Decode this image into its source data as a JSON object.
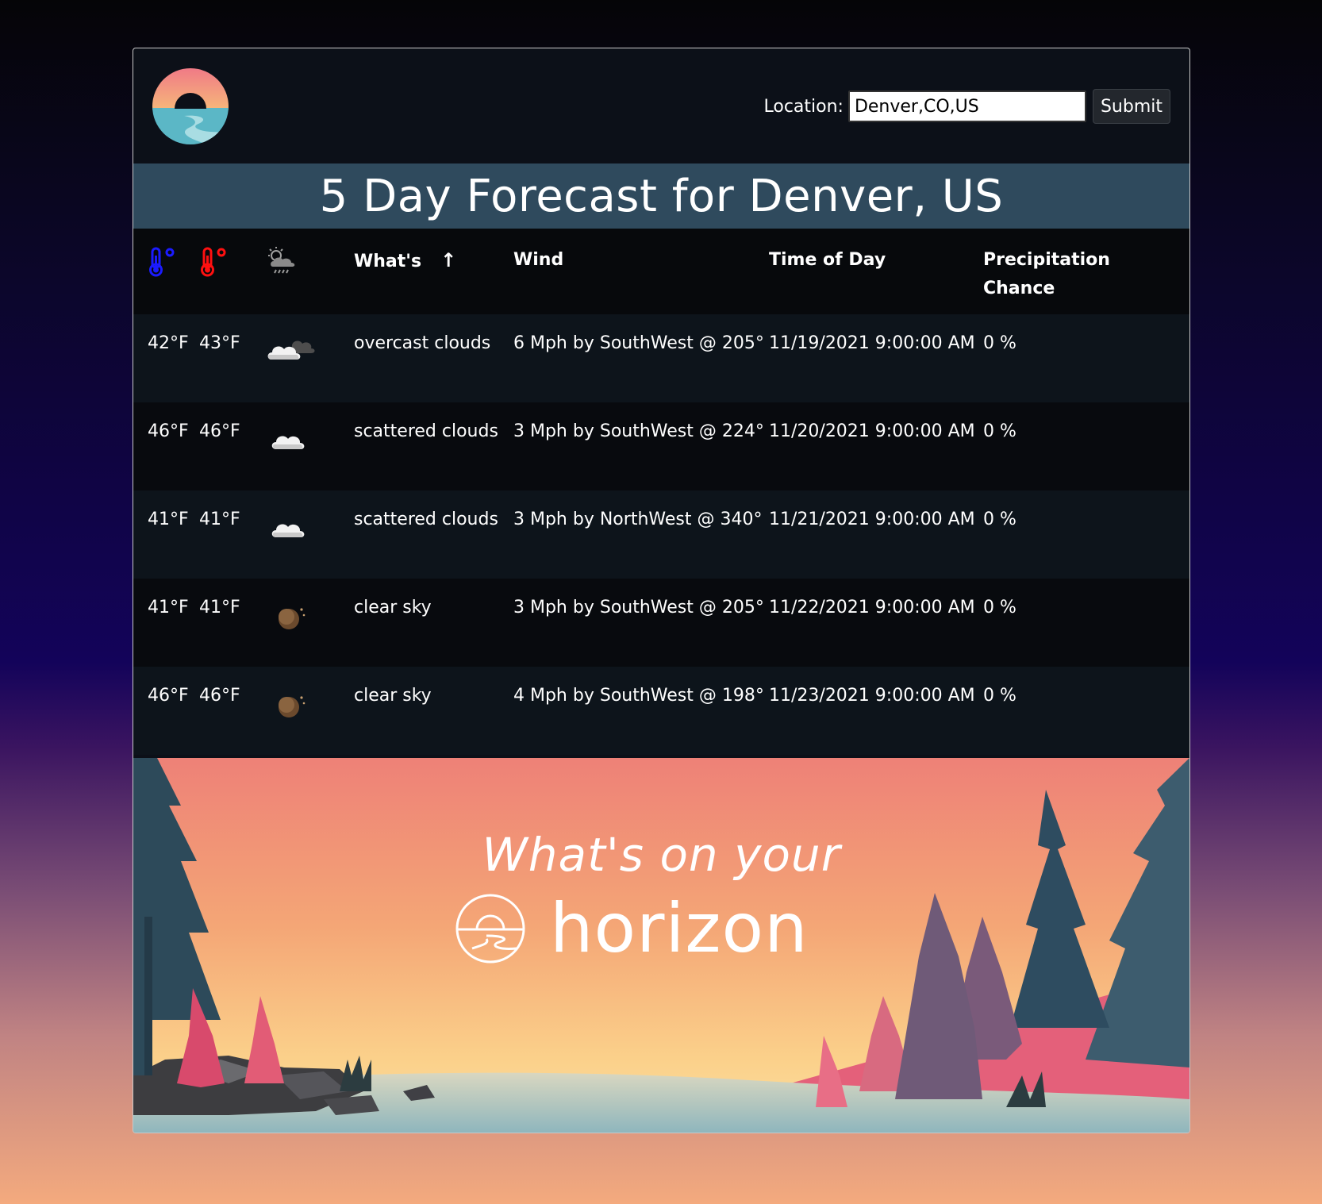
{
  "header": {
    "logo_name": "horizon-logo",
    "location_label": "Location:",
    "location_value": "Denver,CO,US",
    "submit_label": "Submit"
  },
  "title": "5 Day Forecast for Denver, US",
  "table": {
    "columns": [
      "min-temp-icon",
      "max-temp-icon",
      "weather-icon",
      "What's",
      "Wind",
      "Time of Day",
      "Precipitation Chance"
    ],
    "header_whats": "What's",
    "header_wind": "Wind",
    "header_time": "Time of Day",
    "header_precip_1": "Precipitation",
    "header_precip_2": "Chance",
    "sort_arrow": "↑",
    "rows": [
      {
        "min": "42°F",
        "max": "43°F",
        "icon": "overcast-clouds-icon",
        "desc": "overcast clouds",
        "wind": "6 Mph by SouthWest @ 205°",
        "time": "11/19/2021 9:00:00 AM",
        "precip": "0 %"
      },
      {
        "min": "46°F",
        "max": "46°F",
        "icon": "scattered-clouds-icon",
        "desc": "scattered clouds",
        "wind": "3 Mph by SouthWest @ 224°",
        "time": "11/20/2021 9:00:00 AM",
        "precip": "0 %"
      },
      {
        "min": "41°F",
        "max": "41°F",
        "icon": "scattered-clouds-icon",
        "desc": "scattered clouds",
        "wind": "3 Mph by NorthWest @ 340°",
        "time": "11/21/2021 9:00:00 AM",
        "precip": "0 %"
      },
      {
        "min": "41°F",
        "max": "41°F",
        "icon": "clear-sky-night-icon",
        "desc": "clear sky",
        "wind": "3 Mph by SouthWest @ 205°",
        "time": "11/22/2021 9:00:00 AM",
        "precip": "0 %"
      },
      {
        "min": "46°F",
        "max": "46°F",
        "icon": "clear-sky-night-icon",
        "desc": "clear sky",
        "wind": "4 Mph by SouthWest @ 198°",
        "time": "11/23/2021 9:00:00 AM",
        "precip": "0 %"
      }
    ]
  },
  "banner": {
    "tagline": "What's on your",
    "brand": "horizon"
  },
  "colors": {
    "min_temp": "#1b1bff",
    "max_temp": "#ff1010",
    "title_bar": "#2f4a5d",
    "card_bg": "#0c1018"
  }
}
